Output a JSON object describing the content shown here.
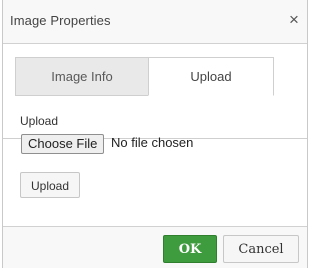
{
  "dialog": {
    "title": "Image Properties",
    "close_glyph": "×"
  },
  "tabs": [
    {
      "label": "Image Info",
      "active": false
    },
    {
      "label": "Upload",
      "active": true
    }
  ],
  "upload_panel": {
    "field_label": "Upload",
    "choose_file_label": "Choose File",
    "no_file_text": "No file chosen",
    "upload_button_label": "Upload"
  },
  "footer": {
    "ok_label": "OK",
    "cancel_label": "Cancel"
  },
  "colors": {
    "ok_button": "#3e9b3e",
    "titlebar_bg": "#f8f8f8",
    "inactive_tab_bg": "#e9e9e9"
  },
  "icons": {
    "close": "close-icon"
  }
}
